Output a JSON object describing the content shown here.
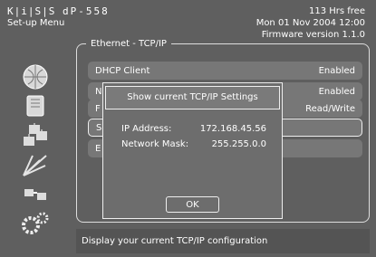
{
  "header": {
    "brand": "K|i|S|S",
    "model": "dP-558",
    "menu_title": "Set-up Menu",
    "free_space": "113 Hrs free",
    "datetime": "Mon 01 Nov 2004 12:00",
    "firmware": "Firmware version 1.1.0"
  },
  "panel": {
    "title": "Ethernet - TCP/IP",
    "rows": [
      {
        "label": "DHCP Client",
        "value": "Enabled"
      },
      {
        "label": "N",
        "value": "Enabled"
      },
      {
        "label": "F",
        "value": "Read/Write"
      },
      {
        "label": "S",
        "value": ""
      },
      {
        "label": "E",
        "value": ""
      }
    ]
  },
  "dialog": {
    "title": "Show current TCP/IP Settings",
    "ip_label": "IP Address:",
    "ip_value": "172.168.45.56",
    "mask_label": "Network Mask:",
    "mask_value": "255.255.0.0",
    "ok_label": "OK"
  },
  "status": {
    "text": "Display your current TCP/IP configuration"
  },
  "icons": [
    "globe-icon",
    "folder-icon",
    "network-icon",
    "antenna-icon",
    "link-icon",
    "gears-icon"
  ],
  "colors": {
    "background": "#5f5f5f",
    "text": "#ffffff",
    "border": "#eeeeee"
  }
}
